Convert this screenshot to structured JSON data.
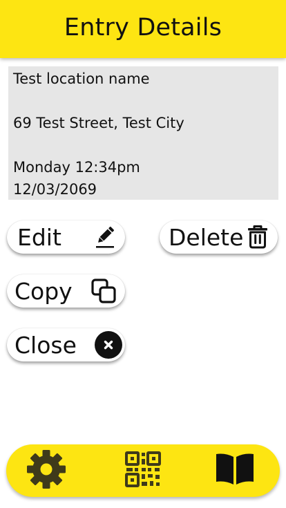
{
  "header": {
    "title": "Entry Details",
    "background_color": "#fde512"
  },
  "entry": {
    "location_name": "Test location name",
    "address": "69 Test Street, Test City",
    "day_time": "Monday 12:34pm",
    "date": "12/03/2069"
  },
  "actions": {
    "edit_label": "Edit",
    "delete_label": "Delete",
    "copy_label": "Copy",
    "close_label": "Close",
    "icons": {
      "edit": "pencil-icon",
      "delete": "trash-icon",
      "copy": "copy-icon",
      "close": "close-circle-icon"
    }
  },
  "bottom_nav": {
    "items": [
      {
        "icon": "gear-icon",
        "color": "#3f3a1a"
      },
      {
        "icon": "qr-code-icon",
        "color": "#3f3a1a"
      },
      {
        "icon": "open-book-icon",
        "color": "#111111"
      }
    ],
    "background_color": "#fde512"
  }
}
